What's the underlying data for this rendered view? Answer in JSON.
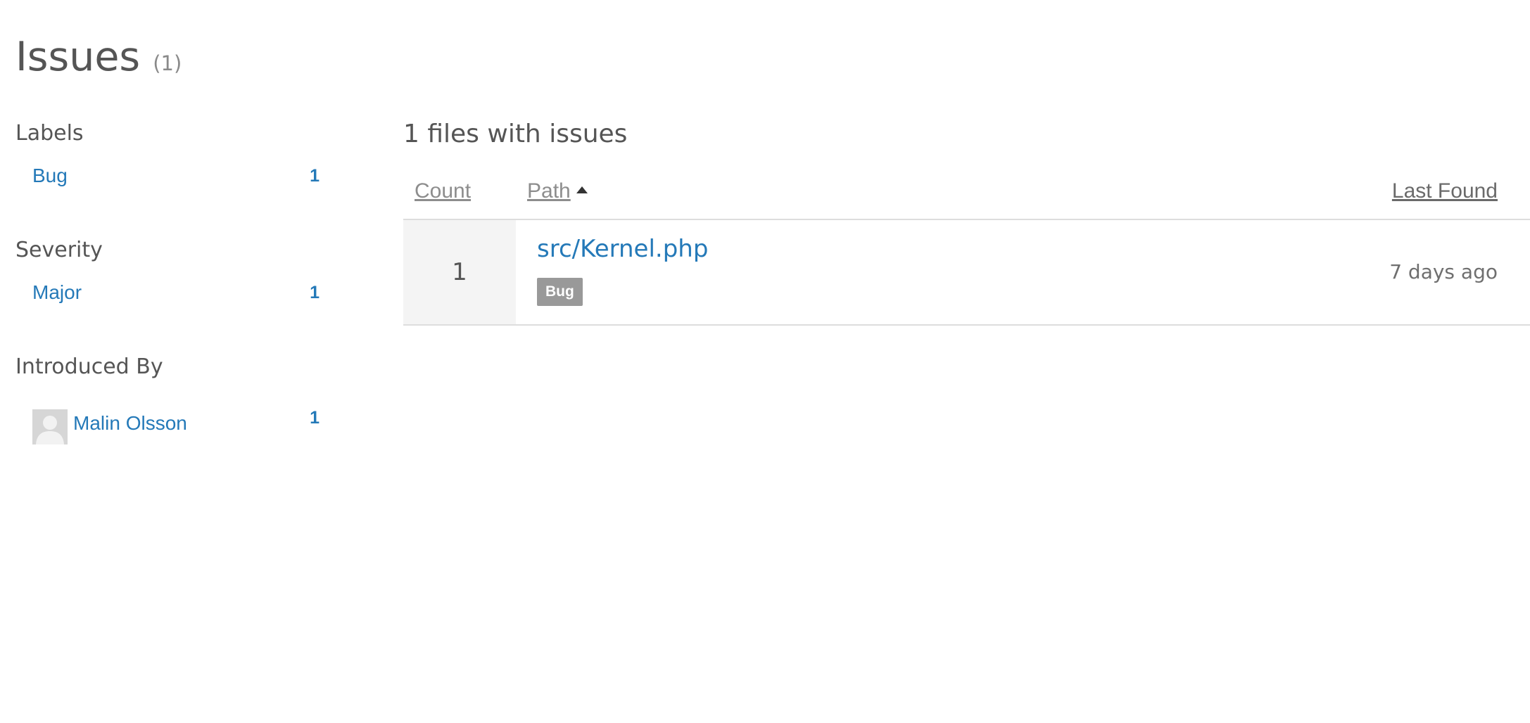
{
  "page": {
    "title": "Issues",
    "count": "(1)"
  },
  "sidebar": {
    "labels": {
      "heading": "Labels",
      "items": [
        {
          "label": "Bug",
          "count": "1"
        }
      ]
    },
    "severity": {
      "heading": "Severity",
      "items": [
        {
          "label": "Major",
          "count": "1"
        }
      ]
    },
    "introduced_by": {
      "heading": "Introduced By",
      "items": [
        {
          "label": "Malin Olsson",
          "count": "1",
          "icon": "user-avatar-placeholder"
        }
      ]
    }
  },
  "main": {
    "heading": "1 files with issues",
    "table": {
      "columns": {
        "count": "Count",
        "path": "Path",
        "last_found": "Last Found"
      },
      "sort": {
        "column": "path",
        "direction": "ascending"
      },
      "rows": [
        {
          "count": "1",
          "path": "src/Kernel.php",
          "label": "Bug",
          "last_found": "7 days ago"
        }
      ]
    }
  },
  "colors": {
    "link": "#2479b8",
    "text": "#555555",
    "badge": "#999999",
    "count_cell_bg": "#f4f4f4",
    "border": "#dddddd"
  }
}
